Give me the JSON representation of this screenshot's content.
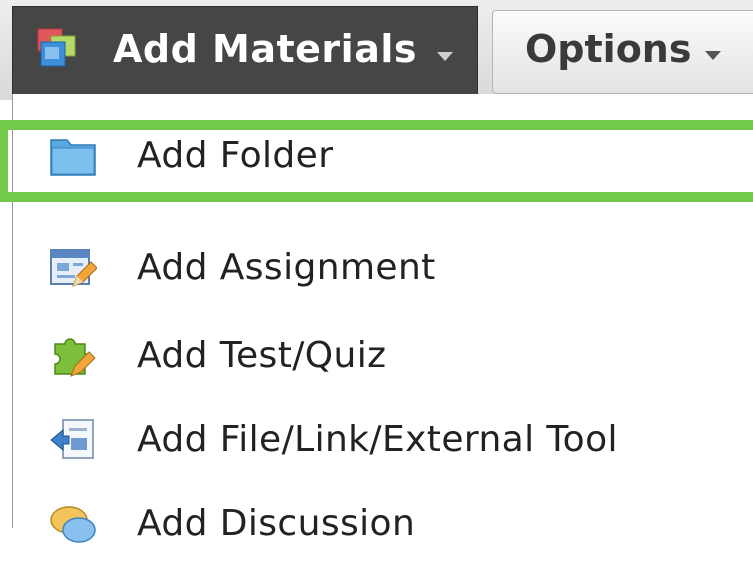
{
  "toolbar": {
    "add_materials_label": "Add Materials",
    "options_label": "Options"
  },
  "menu": {
    "items": [
      {
        "label": "Add Folder",
        "icon": "folder-icon"
      },
      {
        "label": "Add Assignment",
        "icon": "assignment-icon"
      },
      {
        "label": "Add Test/Quiz",
        "icon": "test-quiz-icon"
      },
      {
        "label": "Add File/Link/External Tool",
        "icon": "file-link-icon"
      },
      {
        "label": "Add Discussion",
        "icon": "discussion-icon"
      }
    ]
  },
  "colors": {
    "highlight": "#72c94a",
    "add_materials_bg": "#464646"
  }
}
